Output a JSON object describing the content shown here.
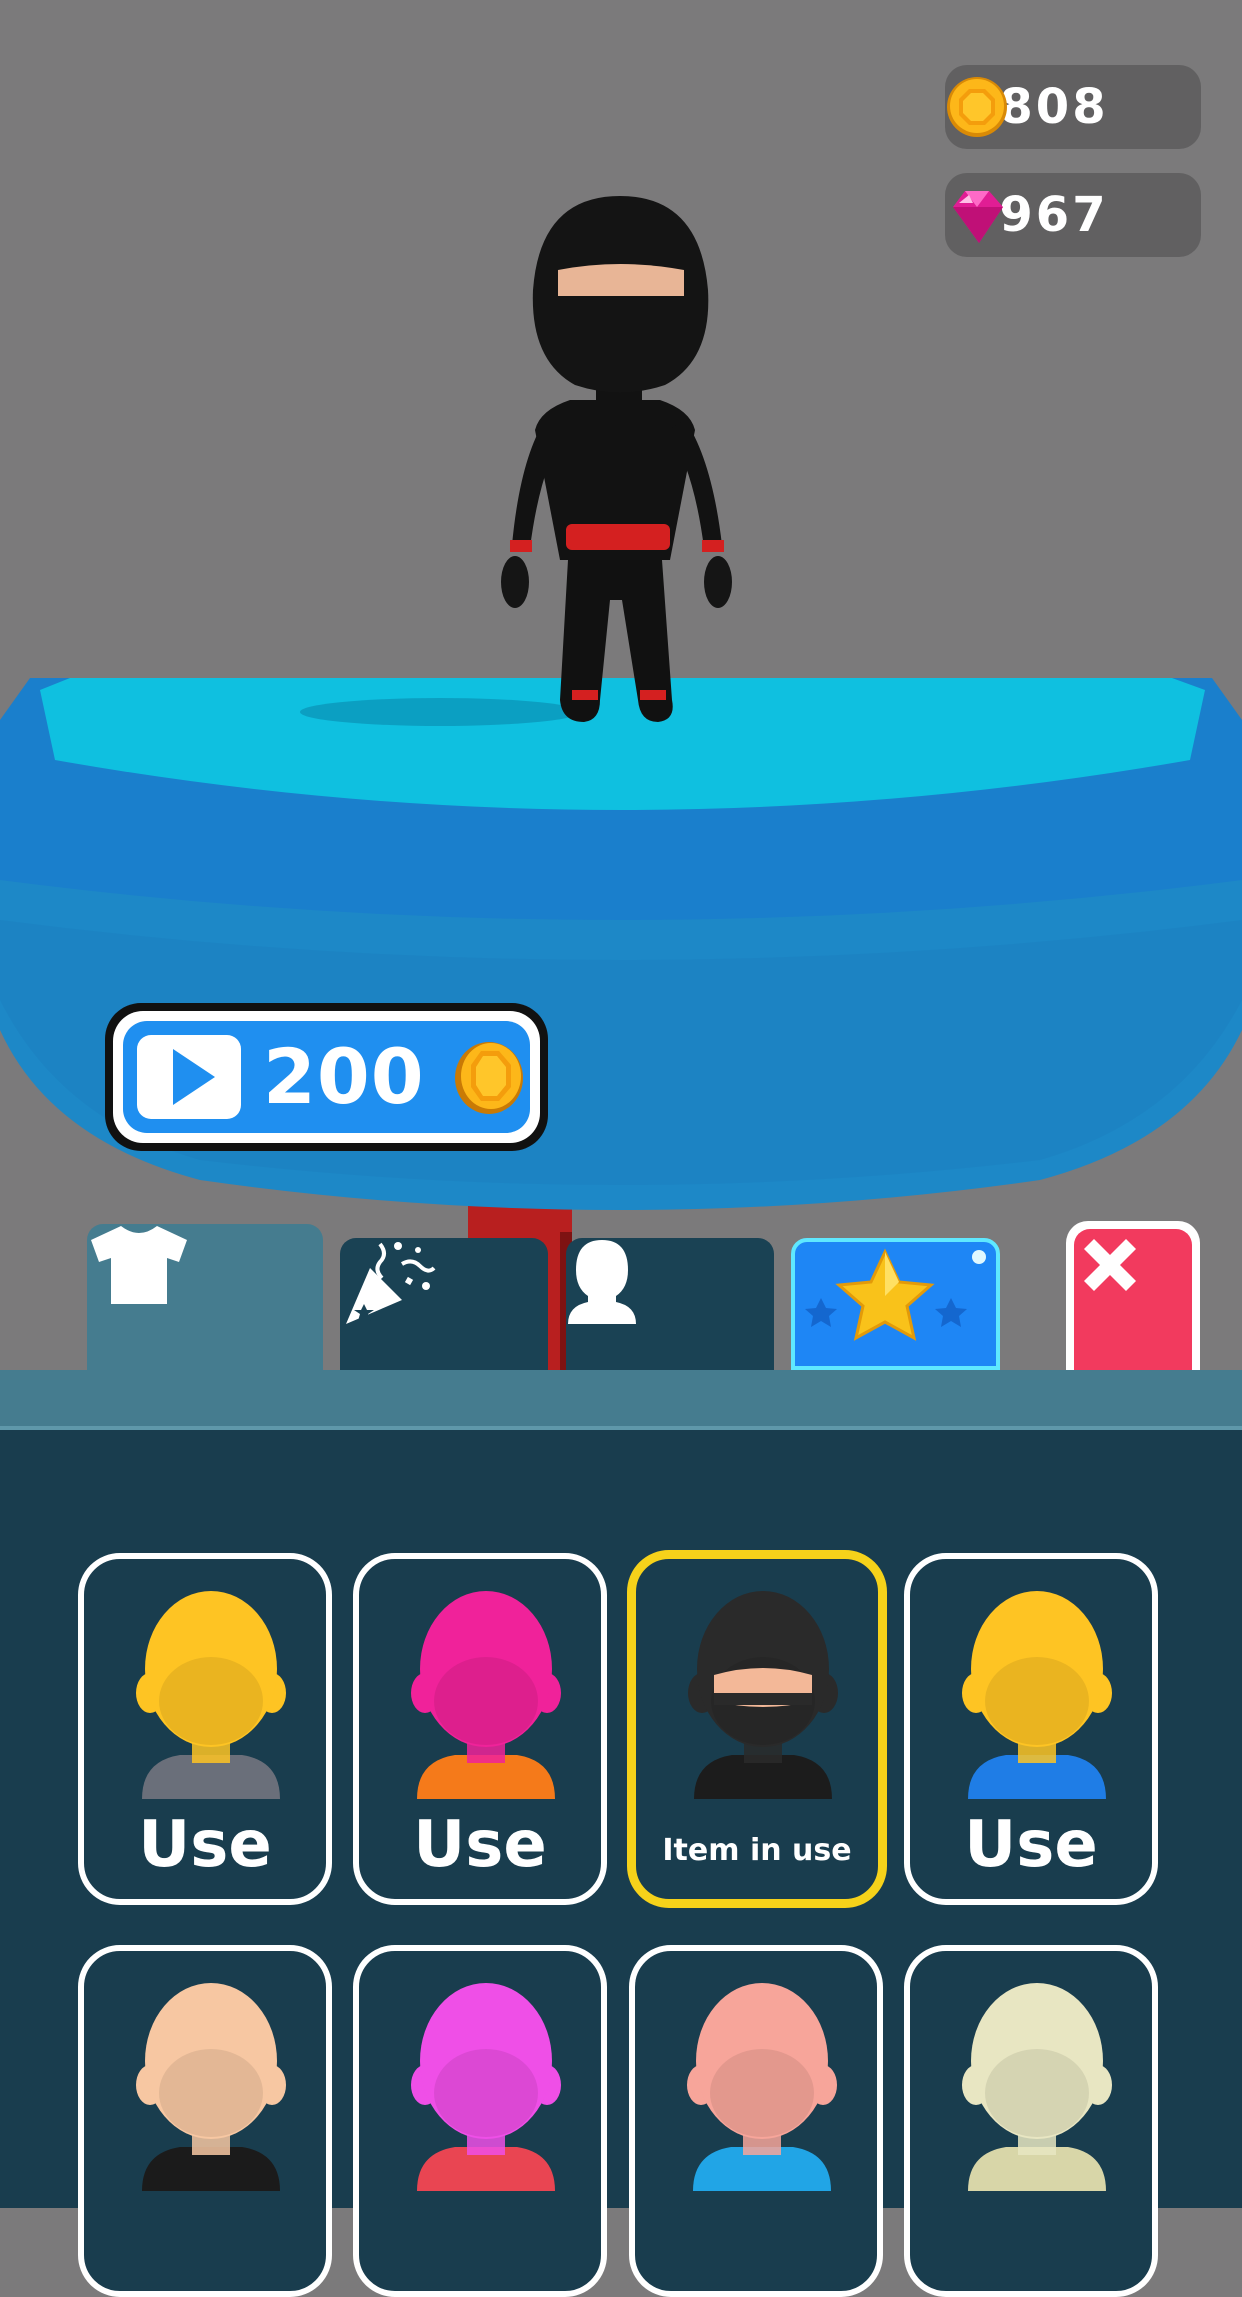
{
  "currency": {
    "coins": "2808",
    "gems": "7967",
    "coin_icon": "coin-icon",
    "gem_icon": "gem-icon"
  },
  "video_reward": {
    "icon": "play-icon",
    "amount": "200",
    "coin_icon": "coin-icon"
  },
  "tabs": [
    {
      "icon": "shirt-icon",
      "active": true
    },
    {
      "icon": "party-popper-icon",
      "active": false
    },
    {
      "icon": "head-icon",
      "active": false
    },
    {
      "icon": "star-icon",
      "active": false
    }
  ],
  "close_icon": "close-icon",
  "skins": [
    {
      "label": "Use",
      "head": "#fec423",
      "shirt": "#6a6f7a",
      "state": "use"
    },
    {
      "label": "Use",
      "head": "#f0229a",
      "shirt": "#f57a1a",
      "state": "use"
    },
    {
      "label": "Item in use",
      "head": "#2a2a2a",
      "shirt": "#1c1c1c",
      "state": "selected"
    },
    {
      "label": "Use",
      "head": "#fec423",
      "shirt": "#1f7de6",
      "state": "use"
    },
    {
      "label": "",
      "head": "#f7c7a2",
      "shirt": "#1b1b1b",
      "state": "locked"
    },
    {
      "label": "",
      "head": "#ef4fe7",
      "shirt": "#e94552",
      "state": "locked"
    },
    {
      "label": "",
      "head": "#f7a59a",
      "shirt": "#21a5e6",
      "state": "locked"
    },
    {
      "label": "",
      "head": "#e8e6c2",
      "shirt": "#d8d6a8",
      "state": "locked"
    }
  ],
  "colors": {
    "background": "#7b7a7b",
    "platform": "#1fb4d6",
    "panel": "#193d4e",
    "accent_blue": "#1e86f5",
    "close_red": "#f23a5e",
    "selected_border": "#f6d21a"
  }
}
